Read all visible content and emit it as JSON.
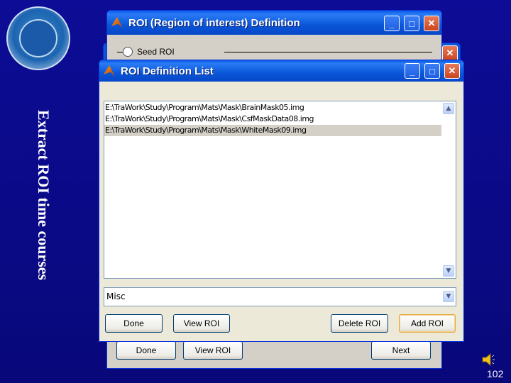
{
  "slide": {
    "title": "Extract ROI time courses",
    "page_number": "102"
  },
  "back_window": {
    "title": "ROI (Region of interest) Definition",
    "seed_roi_label": "Seed ROI",
    "buttons": {
      "done": "Done",
      "view_roi": "View ROI",
      "next": "Next"
    }
  },
  "front_window": {
    "title": "ROI Definition List",
    "list_items": [
      "E:\\TraWork\\Study\\Program\\Mats\\Mask\\BrainMask05.img",
      "E:\\TraWork\\Study\\Program\\Mats\\Mask\\CsfMaskData08.img",
      "E:\\TraWork\\Study\\Program\\Mats\\Mask\\WhiteMask09.img"
    ],
    "selected_index": 2,
    "popup_value": "Misc",
    "buttons": {
      "done": "Done",
      "view_roi": "View ROI",
      "delete_roi": "Delete ROI",
      "add_roi": "Add ROI"
    }
  },
  "icons": {
    "minimize": "minimize-icon",
    "maximize": "maximize-icon",
    "close": "close-icon",
    "speaker": "speaker-icon"
  }
}
